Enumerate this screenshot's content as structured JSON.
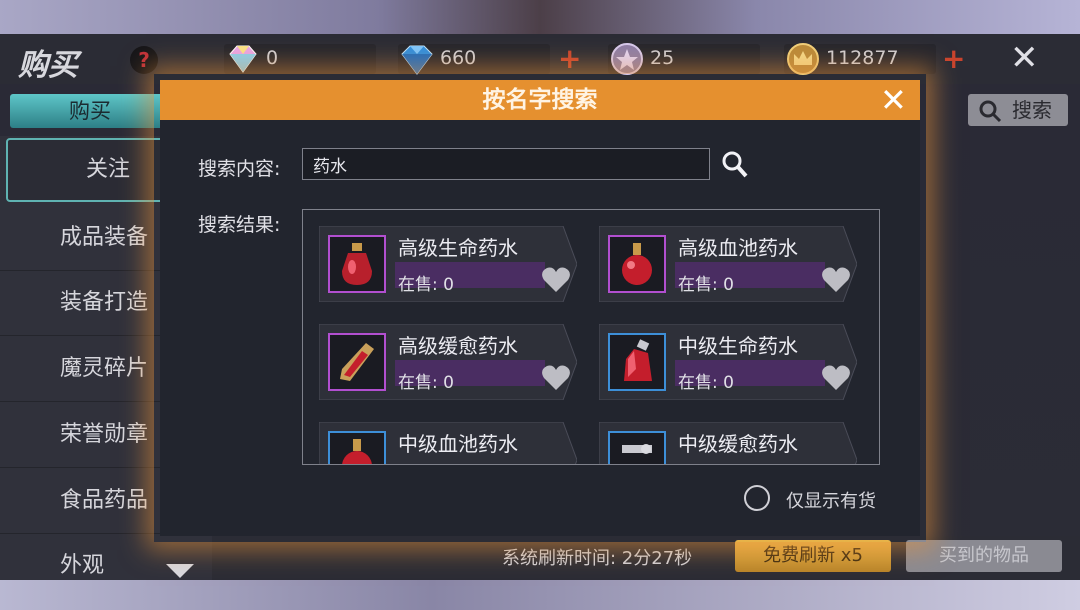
{
  "header": {
    "title": "购买",
    "help": "?",
    "currencies": [
      {
        "icon": "rainbow-diamond-icon",
        "value": "0"
      },
      {
        "icon": "blue-diamond-icon",
        "value": "660"
      },
      {
        "icon": "star-coin-icon",
        "value": "25"
      },
      {
        "icon": "crown-gold-icon",
        "value": "112877"
      }
    ],
    "close": "✕",
    "plus": "+"
  },
  "tab": {
    "buy": "购买"
  },
  "search_button": "搜索",
  "sidebar": {
    "items": [
      {
        "label": "关注"
      },
      {
        "label": "成品装备"
      },
      {
        "label": "装备打造"
      },
      {
        "label": "魔灵碎片"
      },
      {
        "label": "荣誉勋章"
      },
      {
        "label": "食品药品"
      },
      {
        "label": "外观"
      }
    ]
  },
  "modal": {
    "title": "按名字搜索",
    "close": "✕",
    "search_label": "搜索内容:",
    "search_value": "药水",
    "result_label": "搜索结果:",
    "results": [
      {
        "name": "高级生命药水",
        "sale": "在售: 0",
        "frame": "purple",
        "icon": "potion-bottle-icon"
      },
      {
        "name": "高级血池药水",
        "sale": "在售: 0",
        "frame": "purple",
        "icon": "round-flask-icon"
      },
      {
        "name": "高级缓愈药水",
        "sale": "在售: 0",
        "frame": "purple",
        "icon": "vial-icon"
      },
      {
        "name": "中级生命药水",
        "sale": "在售: 0",
        "frame": "blue",
        "icon": "potion-bottle-icon"
      },
      {
        "name": "中级血池药水",
        "sale": "",
        "frame": "blue",
        "icon": "round-flask-icon"
      },
      {
        "name": "中级缓愈药水",
        "sale": "",
        "frame": "blue",
        "icon": "vial-icon"
      }
    ],
    "in_stock_only": "仅显示有货"
  },
  "footer": {
    "refresh_time": "系统刷新时间: 2分27秒",
    "free_refresh": "免费刷新 x5",
    "bought_items": "买到的物品"
  }
}
